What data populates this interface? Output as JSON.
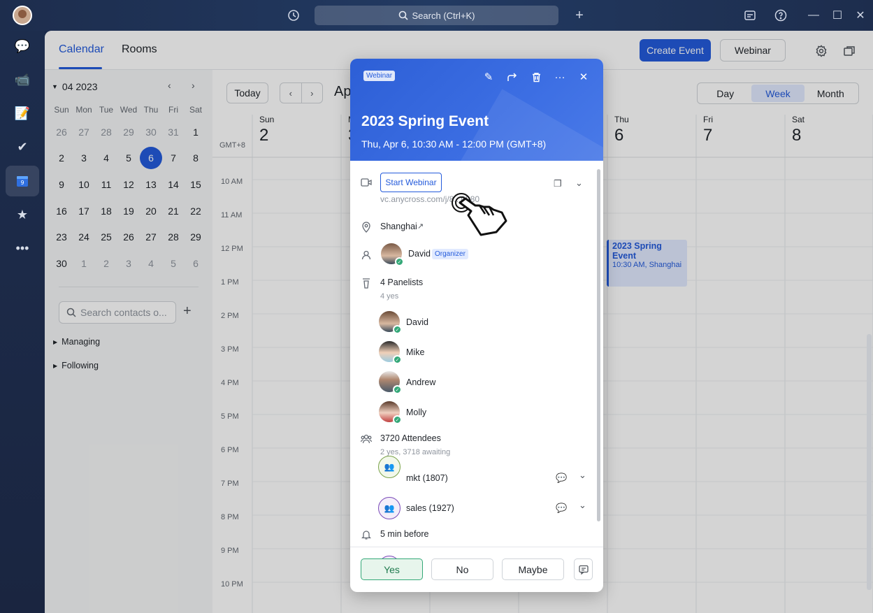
{
  "topbar": {
    "search_placeholder": "Search (Ctrl+K)"
  },
  "header": {
    "tabs": [
      {
        "label": "Calendar"
      },
      {
        "label": "Rooms"
      }
    ],
    "create_event": "Create Event",
    "webinar": "Webinar"
  },
  "mini_calendar": {
    "month": "04 2023",
    "dow": [
      "Sun",
      "Mon",
      "Tue",
      "Wed",
      "Thu",
      "Fri",
      "Sat"
    ],
    "days": [
      [
        "26",
        "27",
        "28",
        "29",
        "30",
        "31",
        "1"
      ],
      [
        "2",
        "3",
        "4",
        "5",
        "6",
        "7",
        "8"
      ],
      [
        "9",
        "10",
        "11",
        "12",
        "13",
        "14",
        "15"
      ],
      [
        "16",
        "17",
        "18",
        "19",
        "20",
        "21",
        "22"
      ],
      [
        "23",
        "24",
        "25",
        "26",
        "27",
        "28",
        "29"
      ],
      [
        "30",
        "1",
        "2",
        "3",
        "4",
        "5",
        "6"
      ]
    ],
    "selected": "6"
  },
  "sidebar": {
    "search_placeholder": "Search contacts o...",
    "groups": [
      {
        "label": "Managing"
      },
      {
        "label": "Following"
      }
    ]
  },
  "week": {
    "today": "Today",
    "range_title": "Ap",
    "views": [
      "Day",
      "Week",
      "Month"
    ],
    "active_view": "Week",
    "timezone": "GMT+8",
    "columns": [
      {
        "dow": "Sun",
        "num": "2"
      },
      {
        "dow": "M",
        "num": "3"
      },
      {
        "dow": "",
        "num": ""
      },
      {
        "dow": "",
        "num": ""
      },
      {
        "dow": "Thu",
        "num": "6"
      },
      {
        "dow": "Fri",
        "num": "7"
      },
      {
        "dow": "Sat",
        "num": "8"
      }
    ],
    "hours": [
      "10 AM",
      "11 AM",
      "12 PM",
      "1 PM",
      "2 PM",
      "3 PM",
      "4 PM",
      "5 PM",
      "6 PM",
      "7 PM",
      "8 PM",
      "9 PM",
      "10 PM"
    ],
    "event": {
      "title": "2023 Spring Event",
      "subtitle": "10:30 AM, Shanghai"
    }
  },
  "card": {
    "badge": "Webinar",
    "title": "2023 Spring Event",
    "time": "Thu, Apr 6, 10:30 AM - 12:00 PM (GMT+8)",
    "start_webinar": "Start Webinar",
    "link": "vc.anycross.com/j/8...0980",
    "location": "Shanghai",
    "organizer_name": "David",
    "organizer_badge": "Organizer",
    "panelists_title": "4 Panelists",
    "panelists_sub": "4 yes",
    "panelists": [
      {
        "name": "David"
      },
      {
        "name": "Mike"
      },
      {
        "name": "Andrew"
      },
      {
        "name": "Molly"
      }
    ],
    "attendees_title": "3720 Attendees",
    "attendees_sub": "2 yes, 3718 awaiting",
    "groups": [
      {
        "name": "mkt (1807)"
      },
      {
        "name": "sales (1927)"
      }
    ],
    "reminder": "5 min before",
    "rsvp": {
      "yes": "Yes",
      "no": "No",
      "maybe": "Maybe"
    }
  },
  "colors": {
    "accent": "#245bdb",
    "success": "#34a878"
  }
}
